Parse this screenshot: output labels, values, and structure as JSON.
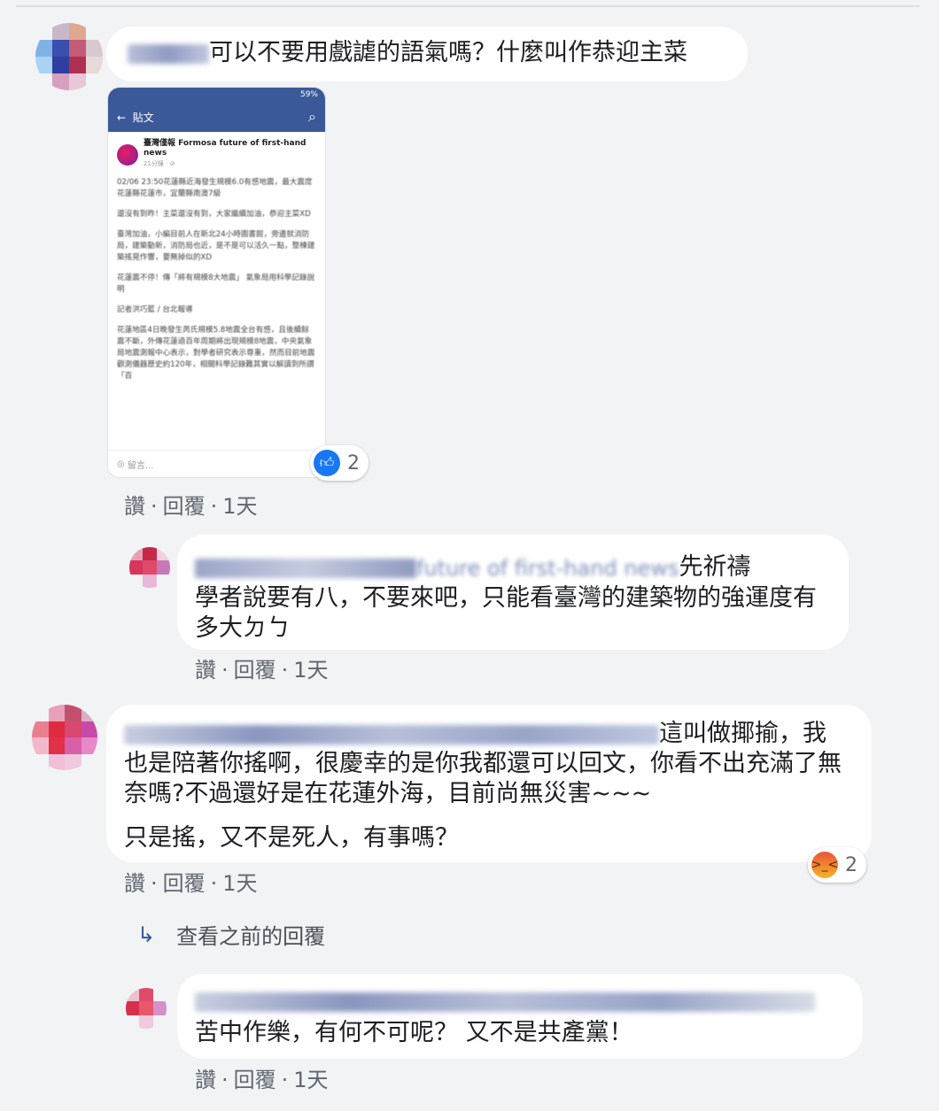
{
  "comments": [
    {
      "text": "可以不要用戲謔的語氣嗎？什麼叫作恭迎主菜",
      "actions": {
        "like": "讚",
        "reply": "回覆",
        "time": "1天"
      },
      "reaction_count": "2",
      "reaction_icon": "like-icon",
      "attachment": {
        "status_bar": "59%",
        "app_title": "貼文",
        "page_name": "臺灣僅報 Formosa future of first-hand news",
        "page_meta": "21分鐘 · ⊘",
        "paragraphs": [
          "02/06 23:50花蓮縣近海發生規模6.0有感地震，最大震度花蓮縣花蓮市，宜蘭縣南澳7級",
          "還沒有到昨！主菜還沒有到，大家繼續加油，恭迎主菜XD",
          "臺灣加油，小編目前人在新北24小時圖書館，旁邊就消防局，建築動新，消防局也近，是不是可以活久一點，整棟建築搖晃作響，要無掉似的XD",
          "花蓮震不停！傳「將有規模8大地震」 氣象局用科學記錄說明",
          "記者洪巧藍 / 台北報導",
          "花蓮地區4日晚發生芮氏規模5.8地震全台有感，且後續餘震不斷，外傳花蓮過百年周期將出現規模8地震，中央氣象局地震測報中心表示，對學者研究表示尊重，然而目前地震觀測儀器歷史約120年，相關科學記錄難其實以解讀到所謂「百"
        ],
        "comment_placeholder": "留言..."
      }
    },
    {
      "blurred_name": "future of first-hand news",
      "text_suffix": "先祈禱",
      "text": "學者說要有八，不要來吧，只能看臺灣的建築物的強運度有多大ㄉㄅ",
      "actions": {
        "like": "讚",
        "reply": "回覆",
        "time": "1天"
      }
    },
    {
      "text_suffix": "這叫做揶揄，我",
      "text": "也是陪著你搖啊，很慶幸的是你我都還可以回文，你看不出充滿了無奈嗎?不過還好是在花蓮外海，目前尚無災害~~~",
      "text2": "只是搖，又不是死人，有事嗎？",
      "actions": {
        "like": "讚",
        "reply": "回覆",
        "time": "1天"
      },
      "reaction_count": "2",
      "reaction_icon": "angry-icon"
    },
    {
      "view_previous": "查看之前的回覆",
      "text": "苦中作樂，有何不可呢？ 又不是共產黨！",
      "actions": {
        "like": "讚",
        "reply": "回覆",
        "time": "1天"
      }
    }
  ],
  "colors": {
    "like_blue": "#1877f2",
    "fb_blue": "#3b5998",
    "link": "#365899",
    "angry": "#f0932b",
    "bubble": "#ffffff",
    "bg": "#f2f3f5"
  }
}
